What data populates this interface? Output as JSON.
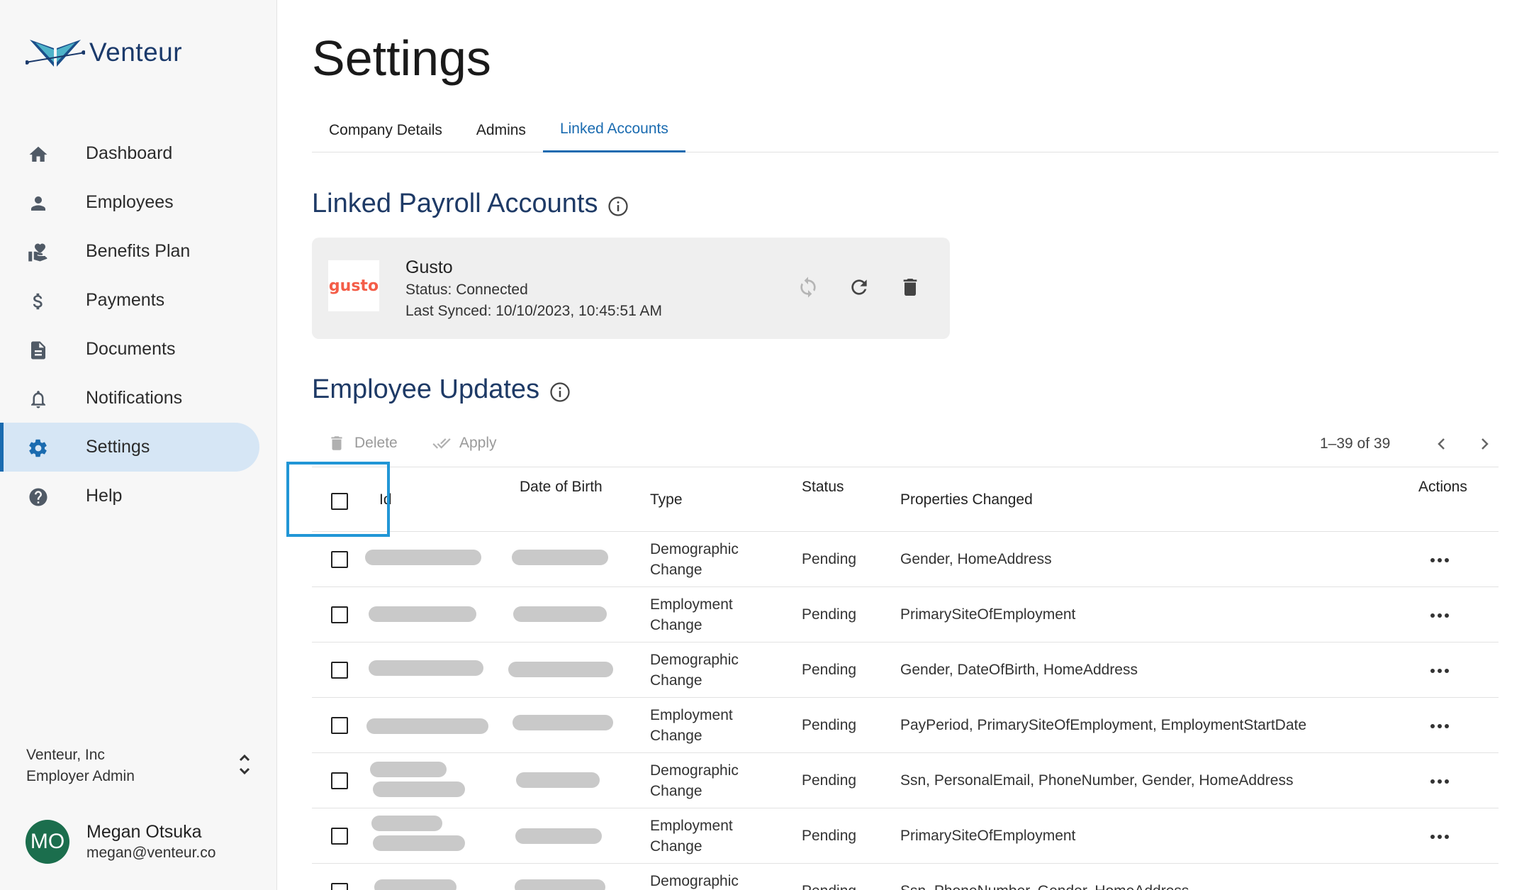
{
  "brand": {
    "name": "Venteur"
  },
  "sidebar": {
    "items": [
      {
        "label": "Dashboard",
        "icon": "home-icon"
      },
      {
        "label": "Employees",
        "icon": "person-icon"
      },
      {
        "label": "Benefits Plan",
        "icon": "benefits-heart-hand-icon"
      },
      {
        "label": "Payments",
        "icon": "dollar-icon"
      },
      {
        "label": "Documents",
        "icon": "document-icon"
      },
      {
        "label": "Notifications",
        "icon": "bell-icon"
      },
      {
        "label": "Settings",
        "icon": "gear-icon",
        "active": true
      },
      {
        "label": "Help",
        "icon": "help-icon"
      }
    ],
    "org": {
      "name": "Venteur, Inc",
      "role": "Employer Admin"
    },
    "user": {
      "initials": "MO",
      "name": "Megan Otsuka",
      "email": "megan@venteur.co"
    }
  },
  "page": {
    "title": "Settings"
  },
  "tabs": [
    {
      "label": "Company Details",
      "active": false
    },
    {
      "label": "Admins",
      "active": false
    },
    {
      "label": "Linked Accounts",
      "active": true
    }
  ],
  "linked_payroll": {
    "title": "Linked Payroll Accounts",
    "account": {
      "logo_text": "gusto",
      "name": "Gusto",
      "status": "Status: Connected",
      "last_synced": "Last Synced: 10/10/2023, 10:45:51 AM"
    }
  },
  "employee_updates": {
    "title": "Employee Updates",
    "toolbar": {
      "delete_label": "Delete",
      "apply_label": "Apply"
    },
    "pagination": {
      "range": "1–39 of 39"
    },
    "columns": {
      "id": "Id",
      "dob": "Date of Birth",
      "type": "Type",
      "status": "Status",
      "properties": "Properties Changed",
      "actions": "Actions"
    },
    "rows": [
      {
        "type_line1": "Demographic",
        "type_line2": "Change",
        "status": "Pending",
        "properties": "Gender, HomeAddress"
      },
      {
        "type_line1": "Employment",
        "type_line2": "Change",
        "status": "Pending",
        "properties": "PrimarySiteOfEmployment"
      },
      {
        "type_line1": "Demographic",
        "type_line2": "Change",
        "status": "Pending",
        "properties": "Gender, DateOfBirth, HomeAddress"
      },
      {
        "type_line1": "Employment",
        "type_line2": "Change",
        "status": "Pending",
        "properties": "PayPeriod, PrimarySiteOfEmployment, EmploymentStartDate"
      },
      {
        "type_line1": "Demographic",
        "type_line2": "Change",
        "status": "Pending",
        "properties": "Ssn, PersonalEmail, PhoneNumber, Gender, HomeAddress"
      },
      {
        "type_line1": "Employment",
        "type_line2": "Change",
        "status": "Pending",
        "properties": "PrimarySiteOfEmployment"
      },
      {
        "type_line1": "Demographic",
        "type_line2": "",
        "status": "Pending",
        "properties": "Ssn, PhoneNumber, Gender, HomeAddress"
      }
    ]
  },
  "colors": {
    "accent": "#1a6bb0",
    "heading": "#1e3a66",
    "active_nav_bg": "#d6e6f5",
    "focus_outline": "#2196d6",
    "gusto_brand": "#f45d48"
  }
}
